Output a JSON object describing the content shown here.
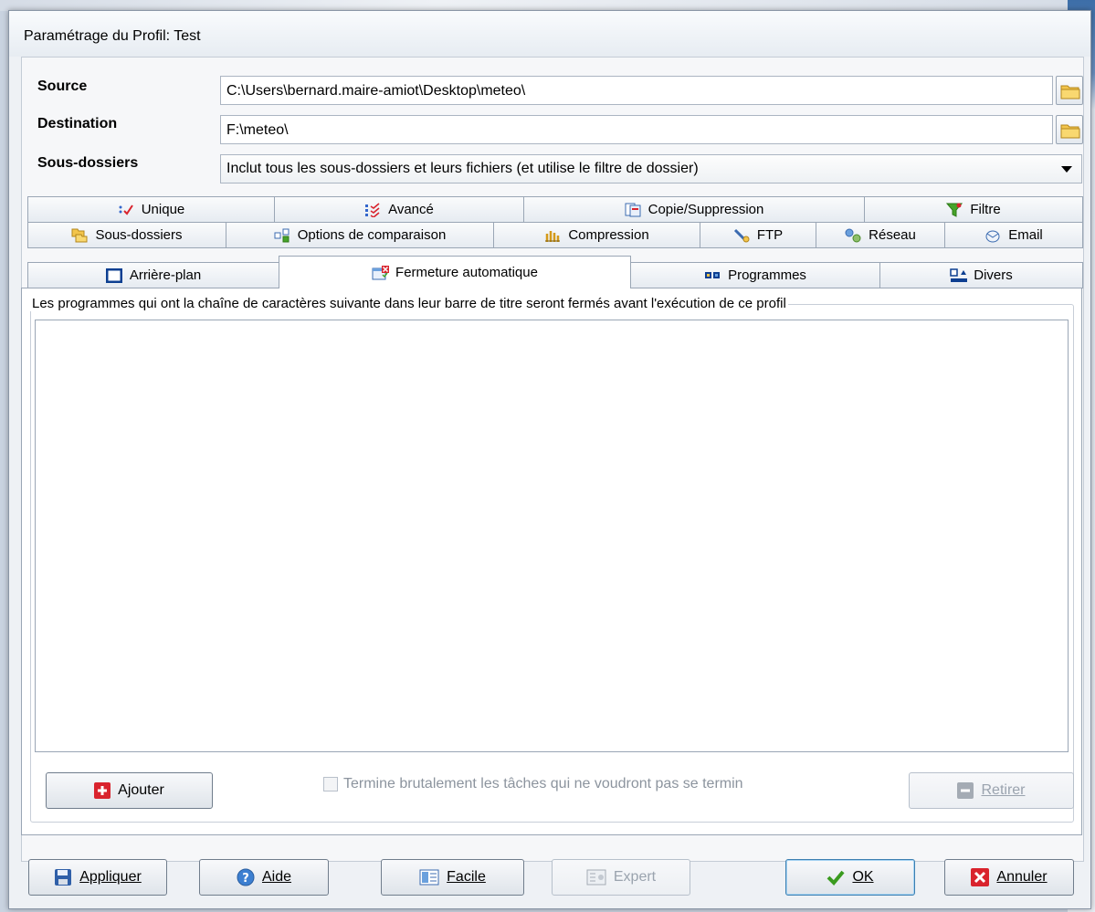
{
  "window": {
    "title": "Paramétrage du Profil: Test"
  },
  "fields": {
    "source_label": "Source",
    "source_value": "C:\\Users\\bernard.maire-amiot\\Desktop\\meteo\\",
    "destination_label": "Destination",
    "destination_value": "F:\\meteo\\",
    "subfolders_label": "Sous-dossiers",
    "subfolders_value": "Inclut tous les sous-dossiers et leurs fichiers (et utilise le filtre de dossier)"
  },
  "tabs": {
    "row1": [
      "Unique",
      "Avancé",
      "Copie/Suppression",
      "Filtre"
    ],
    "row2": [
      "Sous-dossiers",
      "Options de comparaison",
      "Compression",
      "FTP",
      "Réseau",
      "Email"
    ],
    "row3": [
      "Arrière-plan",
      "Fermeture automatique",
      "Programmes",
      "Divers"
    ]
  },
  "content": {
    "group_title": "Les programmes qui ont la chaîne de caractères suivante dans leur barre de titre seront fermés avant l'exécution de ce profil",
    "add_label": "Ajouter",
    "kill_label": "Termine brutalement les tâches qui ne voudront pas se termin",
    "remove_label": "Retirer"
  },
  "bottom": {
    "apply": "Appliquer",
    "help": "Aide",
    "easy": "Facile",
    "expert": "Expert",
    "ok": "OK",
    "cancel": "Annuler"
  },
  "colors": {
    "accent": "#3c7fb1",
    "danger": "#d9232d",
    "ok_green": "#3a9b1f"
  }
}
